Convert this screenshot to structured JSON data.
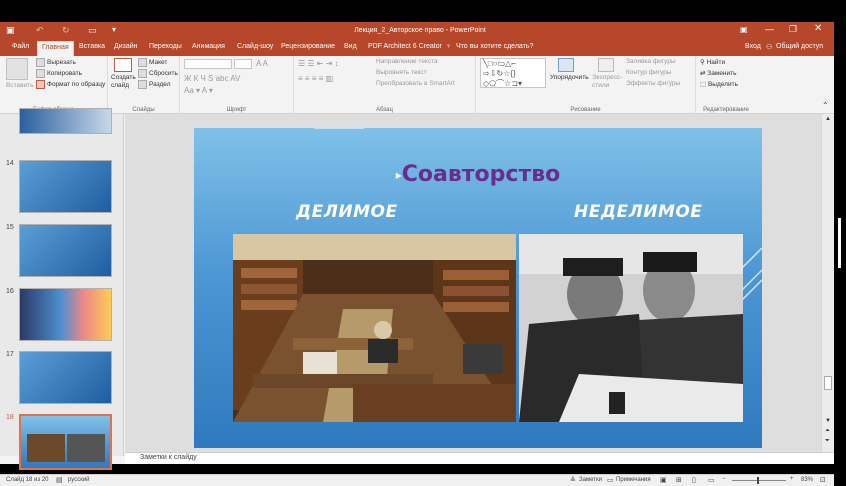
{
  "title_bar": {
    "doc_title": "Лекция_2_Авторское право - PowerPoint"
  },
  "tabs": [
    "Файл",
    "Главная",
    "Вставка",
    "Дизайн",
    "Переходы",
    "Анимация",
    "Слайд-шоу",
    "Рецензирование",
    "Вид",
    "PDF Architect 6 Creator"
  ],
  "tell_me": "Что вы хотите сделать?",
  "account": {
    "signin": "Вход",
    "share": "Общий доступ"
  },
  "ribbon": {
    "clipboard": {
      "paste": "Вставить",
      "cut": "Вырезать",
      "copy": "Копировать",
      "format": "Формат по образцу",
      "label": "Буфер обмена"
    },
    "slides": {
      "new": "Создать слайд",
      "layout": "Макет",
      "reset": "Сбросить",
      "section": "Раздел",
      "label": "Слайды"
    },
    "font": {
      "label": "Шрифт"
    },
    "paragraph": {
      "text_dir": "Направление текста",
      "align_text": "Выровнять текст",
      "smartart": "Преобразовать в SmartArt",
      "label": "Абзац"
    },
    "drawing": {
      "arrange": "Упорядочить",
      "quick_styles": "Экспресс-стили",
      "fill": "Заливка фигуры",
      "outline": "Контур фигуры",
      "effects": "Эффекты фигуры",
      "label": "Рисование"
    },
    "editing": {
      "find": "Найти",
      "replace": "Заменить",
      "select": "Выделить",
      "label": "Редактирование"
    }
  },
  "thumbnails": [
    {
      "num": "14"
    },
    {
      "num": "15"
    },
    {
      "num": "16"
    },
    {
      "num": "17"
    },
    {
      "num": "18",
      "active": true
    }
  ],
  "slide": {
    "title": "Соавторство",
    "left_label": "ДЕЛИМОЕ",
    "right_label": "НЕДЕЛИМОЕ"
  },
  "notes_placeholder": "Заметки к слайду",
  "status": {
    "slide_info": "Слайд 18 из 20",
    "language": "русский",
    "notes_btn": "Заметки",
    "comments_btn": "Примечания",
    "zoom": "83%"
  }
}
